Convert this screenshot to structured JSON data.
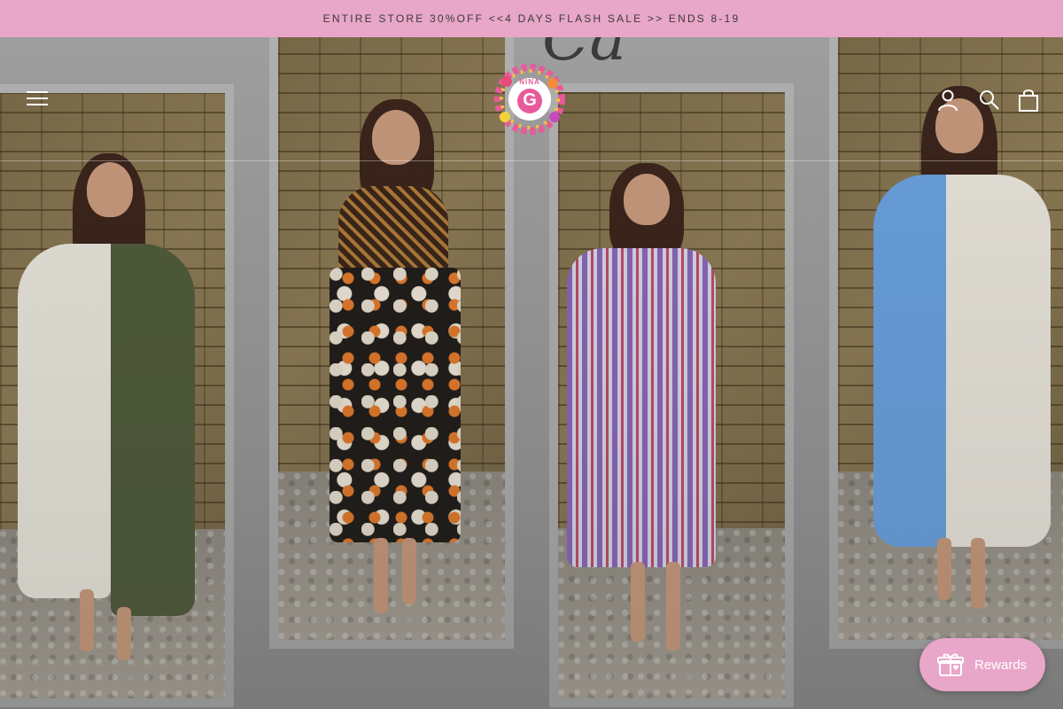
{
  "announcement": {
    "text": "ENTIRE STORE 30%OFF <<4 DAYS FLASH SALE >> ENDS 8-19"
  },
  "header": {
    "logo_text_top": "NINA",
    "logo_letter": "G",
    "menu_icon": "hamburger-menu-icon",
    "account_icon": "account-icon",
    "search_icon": "search-icon",
    "cart_icon": "shopping-bag-icon"
  },
  "hero": {
    "script_text": "Ca",
    "products": [
      {
        "name": "white-and-green-split-kaftan-dress",
        "colors": [
          "#e9e6dc",
          "#4f5a3a"
        ]
      },
      {
        "name": "black-floral-dress-with-embroidered-top",
        "colors": [
          "#1e1b18",
          "#d58a36"
        ]
      },
      {
        "name": "striped-huipil-dress",
        "colors": [
          "#8a66b8",
          "#d8d8e8"
        ]
      },
      {
        "name": "blue-and-white-split-kaftan-dress",
        "colors": [
          "#6aa3e2",
          "#ece8df"
        ]
      }
    ]
  },
  "rewards": {
    "label": "Rewards",
    "icon": "gift-icon",
    "color": "#e8a6c8"
  },
  "colors": {
    "announcement_bg": "#e8a6c8",
    "announcement_text": "#3a3a3a"
  }
}
